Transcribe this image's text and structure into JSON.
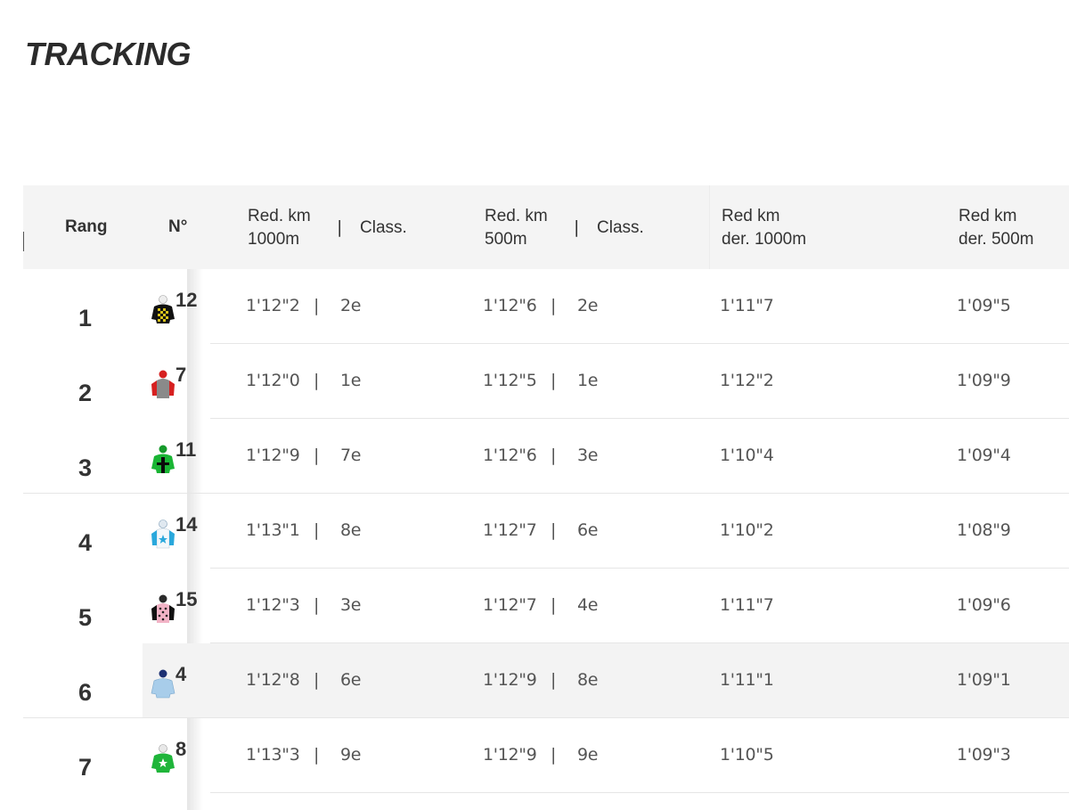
{
  "title": "TRACKING",
  "headers": {
    "rang": "Rang",
    "num": "N°",
    "c1_a": "Red. km",
    "c1_b": "1000m",
    "c1_class": "Class.",
    "c2_a": "Red. km",
    "c2_b": "500m",
    "c2_class": "Class.",
    "c3_a": "Red km",
    "c3_b": "der. 1000m",
    "c4_a": "Red km",
    "c4_b": "der. 500m",
    "sep": "|"
  },
  "rows": [
    {
      "rang": "1",
      "num": "12",
      "silk": "black-yellow-check-icon",
      "r1000": "1'12\"2",
      "c1000": "2e",
      "r500": "1'12\"6",
      "c500": "2e",
      "d1000": "1'11\"7",
      "d500": "1'09\"5"
    },
    {
      "rang": "2",
      "num": "7",
      "silk": "grey-red-sleeves-icon",
      "r1000": "1'12\"0",
      "c1000": "1e",
      "r500": "1'12\"5",
      "c500": "1e",
      "d1000": "1'12\"2",
      "d500": "1'09\"9"
    },
    {
      "rang": "3",
      "num": "11",
      "silk": "green-black-cross-icon",
      "r1000": "1'12\"9",
      "c1000": "7e",
      "r500": "1'12\"6",
      "c500": "3e",
      "d1000": "1'10\"4",
      "d500": "1'09\"4"
    },
    {
      "rang": "4",
      "num": "14",
      "silk": "white-blue-star-icon",
      "r1000": "1'13\"1",
      "c1000": "8e",
      "r500": "1'12\"7",
      "c500": "6e",
      "d1000": "1'10\"2",
      "d500": "1'08\"9"
    },
    {
      "rang": "5",
      "num": "15",
      "silk": "pink-black-dots-icon",
      "r1000": "1'12\"3",
      "c1000": "3e",
      "r500": "1'12\"7",
      "c500": "4e",
      "d1000": "1'11\"7",
      "d500": "1'09\"6"
    },
    {
      "rang": "6",
      "num": "4",
      "silk": "lightblue-navy-cap-icon",
      "r1000": "1'12\"8",
      "c1000": "6e",
      "r500": "1'12\"9",
      "c500": "8e",
      "d1000": "1'11\"1",
      "d500": "1'09\"1"
    },
    {
      "rang": "7",
      "num": "8",
      "silk": "green-white-star-icon",
      "r1000": "1'13\"3",
      "c1000": "9e",
      "r500": "1'12\"9",
      "c500": "9e",
      "d1000": "1'10\"5",
      "d500": "1'09\"3"
    }
  ]
}
